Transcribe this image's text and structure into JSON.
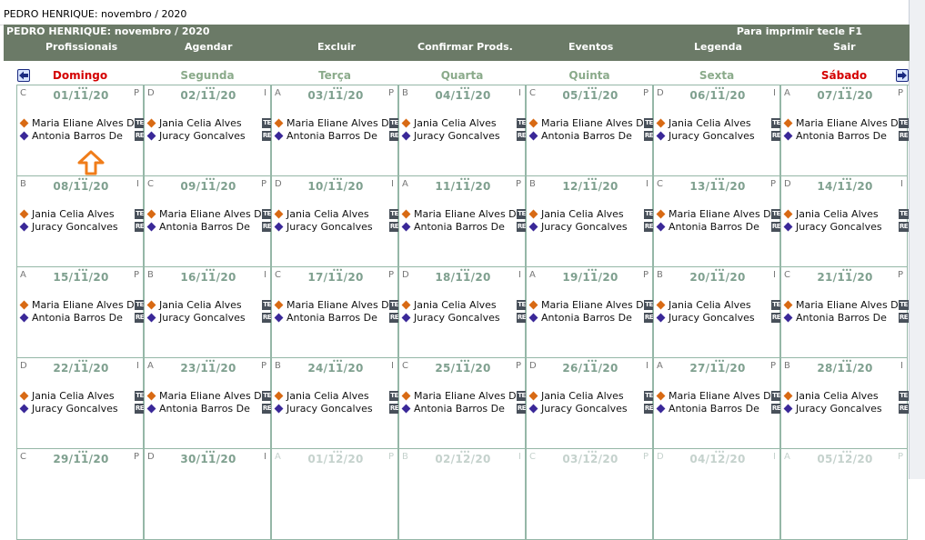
{
  "window": {
    "title": "PEDRO HENRIQUE: novembro / 2020"
  },
  "header": {
    "subtitle": "PEDRO HENRIQUE: novembro / 2020",
    "print_hint": "Para imprimir tecle F1",
    "background": "#6b7a67",
    "menu": [
      "Profissionais",
      "Agendar",
      "Excluir",
      "Confirmar Prods.",
      "Eventos",
      "Legenda",
      "Sair"
    ]
  },
  "nav": {
    "prev_icon": "arrow-left-icon",
    "next_icon": "arrow-right-icon"
  },
  "weekdays": [
    "Domingo",
    "Segunda",
    "Terça",
    "Quarta",
    "Quinta",
    "Sexta",
    "Sábado"
  ],
  "colors": {
    "weekend": "#d40000",
    "weekday": "#8aaa8a",
    "dot_a": "#d86a14",
    "dot_b": "#3a2898"
  },
  "weeks": [
    [
      {
        "date": "01/11/20",
        "letter": "C",
        "shift": "P",
        "e1": "Maria Eliane Alves De",
        "b1": "TE",
        "e2": "Antonia Barros De",
        "b2": "RE"
      },
      {
        "date": "02/11/20",
        "letter": "D",
        "shift": "I",
        "e1": "Jania Celia Alves",
        "b1": "TE",
        "e2": "Juracy Goncalves",
        "b2": "RE"
      },
      {
        "date": "03/11/20",
        "letter": "A",
        "shift": "P",
        "e1": "Maria Eliane Alves De",
        "b1": "TE",
        "e2": "Antonia Barros De",
        "b2": "RE"
      },
      {
        "date": "04/11/20",
        "letter": "B",
        "shift": "I",
        "e1": "Jania Celia Alves",
        "b1": "TE",
        "e2": "Juracy Goncalves",
        "b2": "RE"
      },
      {
        "date": "05/11/20",
        "letter": "C",
        "shift": "P",
        "e1": "Maria Eliane Alves De",
        "b1": "TE",
        "e2": "Antonia Barros De",
        "b2": "RE"
      },
      {
        "date": "06/11/20",
        "letter": "D",
        "shift": "I",
        "e1": "Jania Celia Alves",
        "b1": "TE",
        "e2": "Juracy Goncalves",
        "b2": "RE"
      },
      {
        "date": "07/11/20",
        "letter": "A",
        "shift": "P",
        "e1": "Maria Eliane Alves De",
        "b1": "TE",
        "e2": "Antonia Barros De",
        "b2": "RE"
      }
    ],
    [
      {
        "date": "08/11/20",
        "letter": "B",
        "shift": "I",
        "e1": "Jania Celia Alves",
        "b1": "TE",
        "e2": "Juracy Goncalves",
        "b2": "RE"
      },
      {
        "date": "09/11/20",
        "letter": "C",
        "shift": "P",
        "e1": "Maria Eliane Alves De",
        "b1": "TE",
        "e2": "Antonia Barros De",
        "b2": "RE"
      },
      {
        "date": "10/11/20",
        "letter": "D",
        "shift": "I",
        "e1": "Jania Celia Alves",
        "b1": "TE",
        "e2": "Juracy Goncalves",
        "b2": "RE"
      },
      {
        "date": "11/11/20",
        "letter": "A",
        "shift": "P",
        "e1": "Maria Eliane Alves De",
        "b1": "TE",
        "e2": "Antonia Barros De",
        "b2": "RE"
      },
      {
        "date": "12/11/20",
        "letter": "B",
        "shift": "I",
        "e1": "Jania Celia Alves",
        "b1": "TE",
        "e2": "Juracy Goncalves",
        "b2": "RE"
      },
      {
        "date": "13/11/20",
        "letter": "C",
        "shift": "P",
        "e1": "Maria Eliane Alves De",
        "b1": "TE",
        "e2": "Antonia Barros De",
        "b2": "RE"
      },
      {
        "date": "14/11/20",
        "letter": "D",
        "shift": "I",
        "e1": "Jania Celia Alves",
        "b1": "TE",
        "e2": "Juracy Goncalves",
        "b2": "RE"
      }
    ],
    [
      {
        "date": "15/11/20",
        "letter": "A",
        "shift": "P",
        "e1": "Maria Eliane Alves De",
        "b1": "TE",
        "e2": "Antonia Barros De",
        "b2": "RE"
      },
      {
        "date": "16/11/20",
        "letter": "B",
        "shift": "I",
        "e1": "Jania Celia Alves",
        "b1": "TE",
        "e2": "Juracy Goncalves",
        "b2": "RE"
      },
      {
        "date": "17/11/20",
        "letter": "C",
        "shift": "P",
        "e1": "Maria Eliane Alves De",
        "b1": "TE",
        "e2": "Antonia Barros De",
        "b2": "RE"
      },
      {
        "date": "18/11/20",
        "letter": "D",
        "shift": "I",
        "e1": "Jania Celia Alves",
        "b1": "TE",
        "e2": "Juracy Goncalves",
        "b2": "RE"
      },
      {
        "date": "19/11/20",
        "letter": "A",
        "shift": "P",
        "e1": "Maria Eliane Alves De",
        "b1": "TE",
        "e2": "Antonia Barros De",
        "b2": "RE"
      },
      {
        "date": "20/11/20",
        "letter": "B",
        "shift": "I",
        "e1": "Jania Celia Alves",
        "b1": "TE",
        "e2": "Juracy Goncalves",
        "b2": "RE"
      },
      {
        "date": "21/11/20",
        "letter": "C",
        "shift": "P",
        "e1": "Maria Eliane Alves De",
        "b1": "TE",
        "e2": "Antonia Barros De",
        "b2": "RE"
      }
    ],
    [
      {
        "date": "22/11/20",
        "letter": "D",
        "shift": "I",
        "e1": "Jania Celia Alves",
        "b1": "TE",
        "e2": "Juracy Goncalves",
        "b2": "RE"
      },
      {
        "date": "23/11/20",
        "letter": "A",
        "shift": "P",
        "e1": "Maria Eliane Alves De",
        "b1": "TE",
        "e2": "Antonia Barros De",
        "b2": "RE"
      },
      {
        "date": "24/11/20",
        "letter": "B",
        "shift": "I",
        "e1": "Jania Celia Alves",
        "b1": "TE",
        "e2": "Juracy Goncalves",
        "b2": "RE"
      },
      {
        "date": "25/11/20",
        "letter": "C",
        "shift": "P",
        "e1": "Maria Eliane Alves De",
        "b1": "TE",
        "e2": "Antonia Barros De",
        "b2": "RE"
      },
      {
        "date": "26/11/20",
        "letter": "D",
        "shift": "I",
        "e1": "Jania Celia Alves",
        "b1": "TE",
        "e2": "Juracy Goncalves",
        "b2": "RE"
      },
      {
        "date": "27/11/20",
        "letter": "A",
        "shift": "P",
        "e1": "Maria Eliane Alves De",
        "b1": "TE",
        "e2": "Antonia Barros De",
        "b2": "RE"
      },
      {
        "date": "28/11/20",
        "letter": "B",
        "shift": "I",
        "e1": "Jania Celia Alves",
        "b1": "TE",
        "e2": "Juracy Goncalves",
        "b2": "RE"
      }
    ],
    [
      {
        "date": "29/11/20",
        "letter": "C",
        "shift": "P"
      },
      {
        "date": "30/11/20",
        "letter": "D",
        "shift": "I"
      },
      {
        "date": "01/12/20",
        "letter": "A",
        "shift": "P",
        "faded": true
      },
      {
        "date": "02/12/20",
        "letter": "B",
        "shift": "I",
        "faded": true
      },
      {
        "date": "03/12/20",
        "letter": "C",
        "shift": "P",
        "faded": true
      },
      {
        "date": "04/12/20",
        "letter": "D",
        "shift": "I",
        "faded": true
      },
      {
        "date": "05/12/20",
        "letter": "A",
        "shift": "P",
        "faded": true
      }
    ]
  ]
}
